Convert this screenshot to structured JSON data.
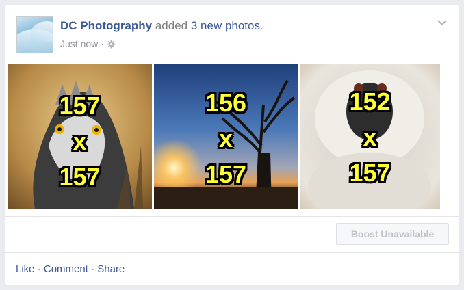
{
  "post": {
    "page_name": "DC Photography",
    "action_text": "added",
    "count_text": "3 new photos",
    "period": ".",
    "timestamp": "Just now",
    "separator": "·"
  },
  "photos": [
    {
      "subject": "eagle",
      "width_label": "157",
      "x_label": "x",
      "height_label": "157"
    },
    {
      "subject": "baobab-sunset",
      "width_label": "156",
      "x_label": "x",
      "height_label": "157"
    },
    {
      "subject": "monkey",
      "width_label": "152",
      "x_label": "x",
      "height_label": "157"
    }
  ],
  "boost_button": {
    "label": "Boost Unavailable"
  },
  "actions": {
    "like": "Like",
    "comment": "Comment",
    "share": "Share",
    "separator": "·"
  },
  "colors": {
    "link": "#3b5998",
    "muted": "#90949c",
    "label_yellow": "#ffff33"
  },
  "icons": [
    "gear-icon",
    "chevron-down-icon"
  ]
}
